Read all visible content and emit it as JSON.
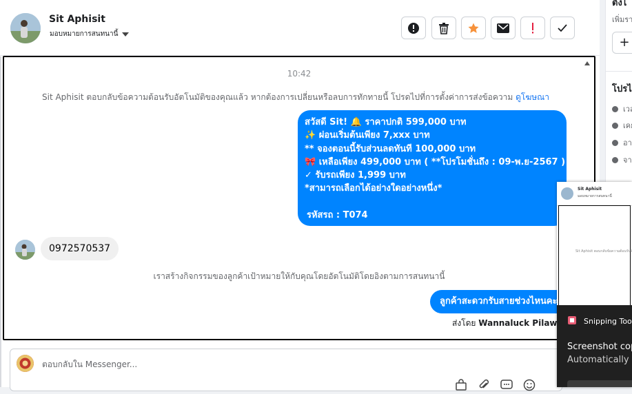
{
  "header": {
    "contact_name": "Sit Aphisit",
    "assign_label": "มอบหมายการสนทนานี้",
    "toolbar": [
      "spam-icon",
      "delete-icon",
      "star-icon",
      "mail-icon",
      "important-icon",
      "done-icon"
    ]
  },
  "chat": {
    "time": "10:42",
    "system_msg_1": "Sit Aphisit ตอบกลับข้อความต้อนรับอัตโนมัติของคุณแล้ว หากต้องการเปลี่ยนหรือลบการทักทายนี้ โปรดไปที่การตั้งค่าการส่งข้อความ",
    "system_msg_1_link": "ดูโฆษณา",
    "outgoing_message_1": [
      "สวัสดี Sit! 🔔 ราคาปกติ 599,000 บาท",
      "✨ ผ่อนเริ่มต้นเพียง 7,xxx บาท",
      "** จองตอนนี้รับส่วนลดทันที 100,000 บาท",
      "🎀 เหลือเพียง 499,000 บาท ( **โปรโมชั่นถึง : 09-พ.ย-2567 )",
      "✓ รับรถเพียง 1,999 บาท",
      "*สามารถเลือกได้อย่างใดอย่างหนึ่ง*",
      "",
      "รหัสรถ : T074"
    ],
    "incoming_message_1": "0972570537",
    "system_msg_2": "เราสร้างกิจกรรมของลูกค้าเป้าหมายให้กับคุณโดยอัตโนมัติโดยอิงตามการสนทนานี้",
    "outgoing_message_2": "ลูกค้าสะดวกรับสายช่วงไหนคะ",
    "sent_by_label": "ส่งโดย",
    "sent_by_name": "Wannaluck Pilawan"
  },
  "reply": {
    "placeholder": "ตอบกลับใน Messenger...",
    "icons": [
      "bag-icon",
      "attach-icon",
      "saved-reply-icon",
      "emoji-icon"
    ]
  },
  "sidebar": {
    "title": "ตั้งไ",
    "subtitle": "เพิ่มรา",
    "add_label": "+",
    "profile_title": "โปรไ",
    "rows": [
      "เวล",
      "เคย",
      "อา",
      "จา"
    ]
  },
  "popup": {
    "name": "Sit Aphisit",
    "assign": "มอบหมายการสนทนานี้",
    "preview": "Sit Aphisit ตอบกลับข้อความต้อนรับอัตโนมัติ"
  },
  "snipping_tool": {
    "title": "Snipping Tool",
    "line1": "Screenshot copied",
    "line2": "Automatically saved"
  },
  "colors": {
    "outgoing_bubble": "#0084ff",
    "link": "#1877f2",
    "star": "#f7923b",
    "important": "#e41e3f"
  }
}
